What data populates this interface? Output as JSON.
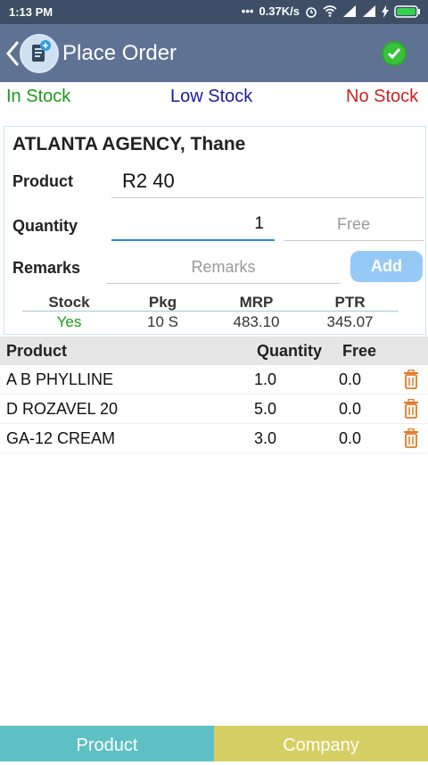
{
  "status": {
    "time": "1:13 PM",
    "speed": "0.37K/s"
  },
  "header": {
    "title": "Place Order"
  },
  "legend": {
    "in_stock": "In Stock",
    "low_stock": "Low Stock",
    "no_stock": "No Stock"
  },
  "form": {
    "agency": "ATLANTA AGENCY, Thane",
    "product_label": "Product",
    "product_value": "R2  40",
    "quantity_label": "Quantity",
    "quantity_value": "1",
    "free_placeholder": "Free",
    "remarks_label": "Remarks",
    "remarks_placeholder": "Remarks",
    "add_label": "Add"
  },
  "info": {
    "headers": [
      "Stock",
      "Pkg",
      "MRP",
      "PTR"
    ],
    "values": [
      "Yes",
      "10 S",
      "483.10",
      "345.07"
    ]
  },
  "list": {
    "headers": {
      "product": "Product",
      "quantity": "Quantity",
      "free": "Free"
    },
    "rows": [
      {
        "product": "A B PHYLLINE",
        "quantity": "1.0",
        "free": "0.0"
      },
      {
        "product": "D ROZAVEL 20",
        "quantity": "5.0",
        "free": "0.0"
      },
      {
        "product": "GA-12 CREAM",
        "quantity": "3.0",
        "free": "0.0"
      }
    ]
  },
  "tabs": {
    "product": "Product",
    "company": "Company"
  },
  "colors": {
    "in_stock": "#1a9c1a",
    "low_stock": "#1a1aa0",
    "no_stock": "#cc2222",
    "tab_product": "#5ec0c4",
    "tab_company": "#d6cf63"
  }
}
